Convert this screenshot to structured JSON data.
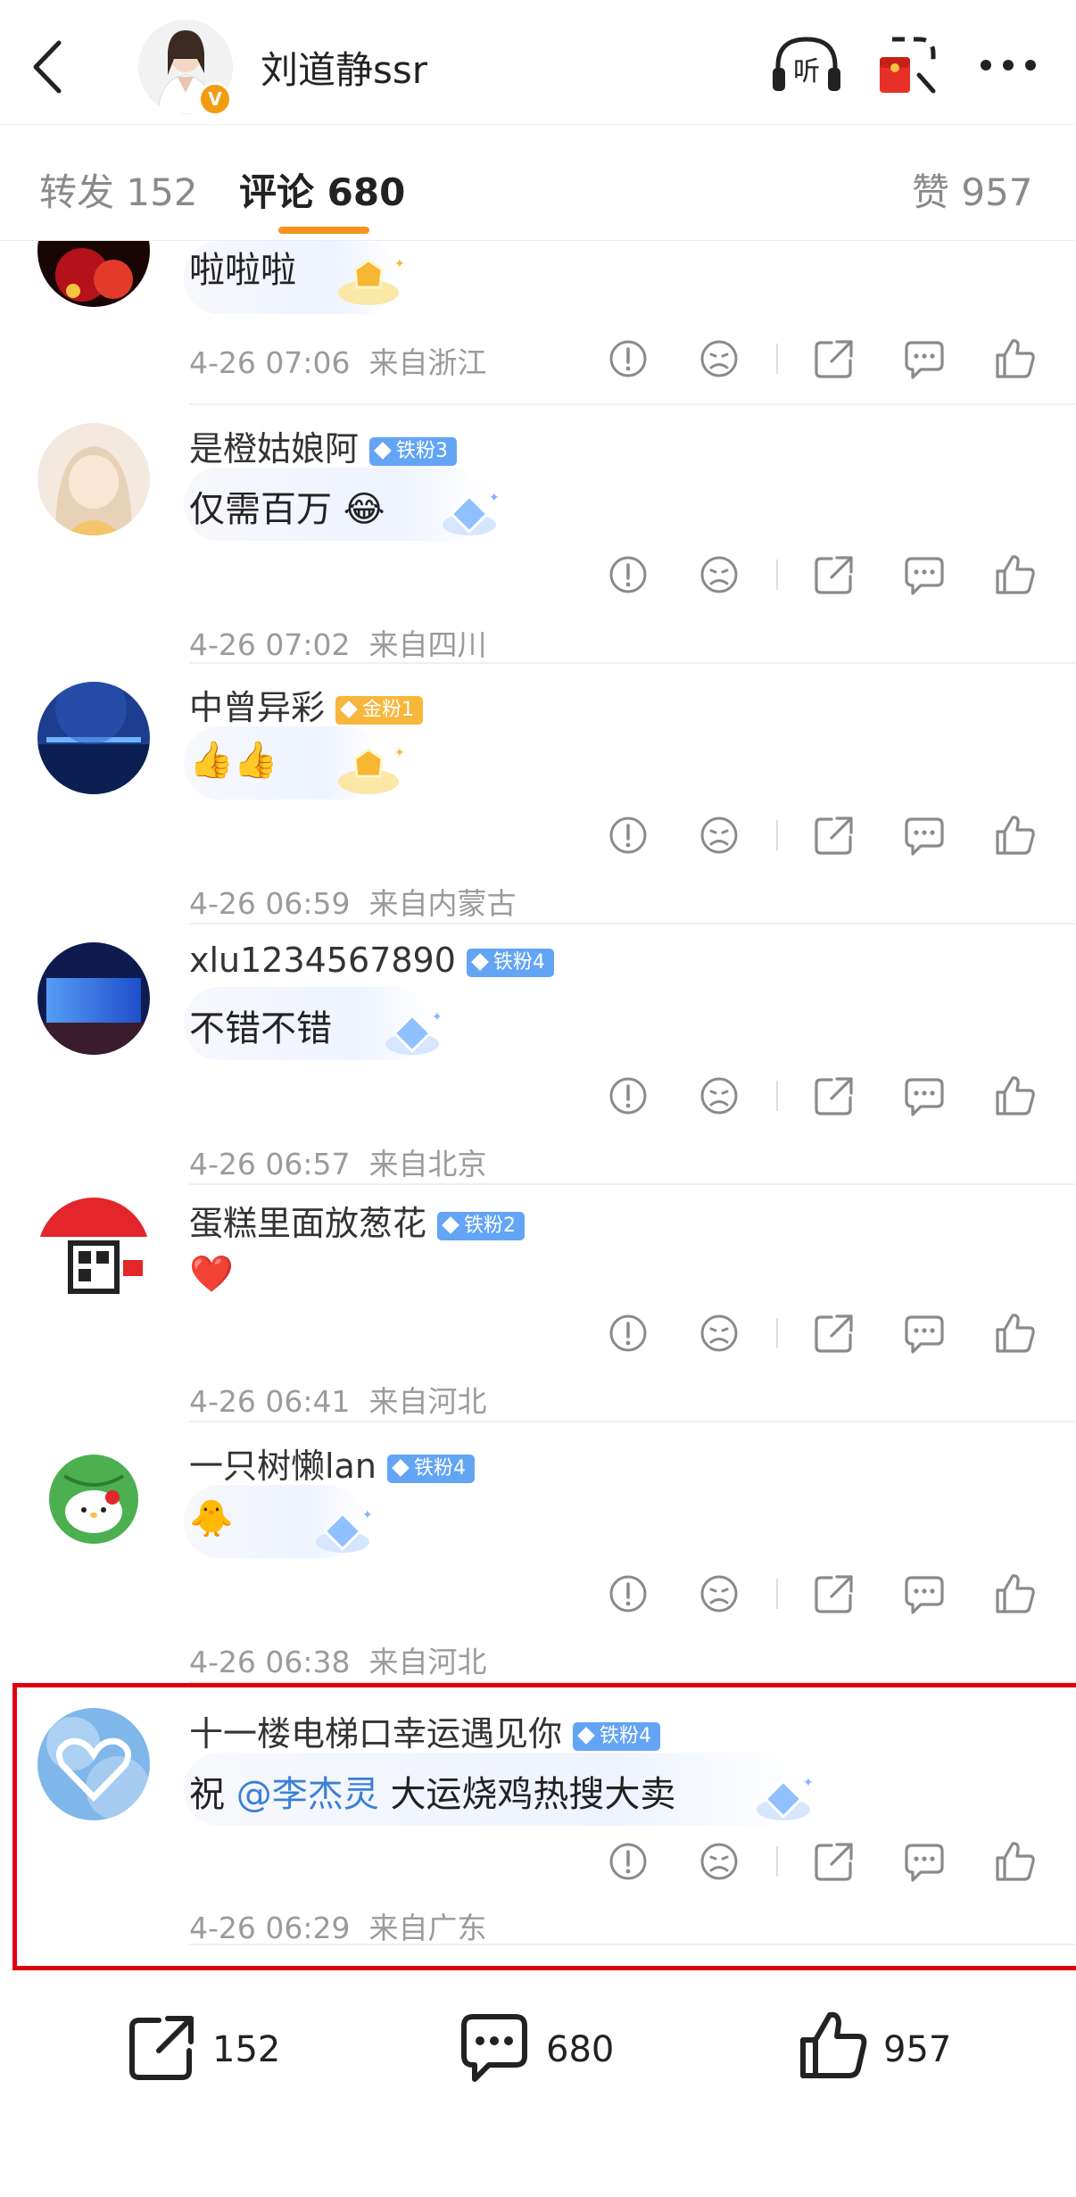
{
  "header": {
    "back_icon": "chevron-left-icon",
    "user_name": "刘道静ssr",
    "verified_badge": "V",
    "listen_label": "听",
    "more_icon": "more-dots-icon"
  },
  "tabs": [
    {
      "label": "转发 152",
      "active": false
    },
    {
      "label": "评论 680",
      "active": true
    },
    {
      "label": "赞 957",
      "active": false
    }
  ],
  "comments": [
    {
      "name": "",
      "badge": "",
      "content": "啦啦啦",
      "time": "4-26 07:06",
      "location": "来自浙江",
      "decor": "gold-star"
    },
    {
      "name": "是橙姑娘阿",
      "badge": "铁粉3",
      "content": "仅需百万",
      "emoji": "😂",
      "time": "4-26 07:02",
      "location": "来自四川",
      "decor": "blue-diamond"
    },
    {
      "name": "中曾异彩",
      "badge": "金粉1",
      "content": "",
      "emoji": "👍👍",
      "time": "4-26 06:59",
      "location": "来自内蒙古",
      "decor": "gold-star"
    },
    {
      "name": "xlu1234567890",
      "badge": "铁粉4",
      "content": "不错不错",
      "time": "4-26 06:57",
      "location": "来自北京",
      "decor": "blue-diamond"
    },
    {
      "name": "蛋糕里面放葱花",
      "badge": "铁粉2",
      "content": "",
      "emoji": "❤️",
      "time": "4-26 06:41",
      "location": "来自河北",
      "decor": ""
    },
    {
      "name": "一只树懒lan",
      "badge": "铁粉4",
      "content": "",
      "emoji": "🐥",
      "time": "4-26 06:38",
      "location": "来自河北",
      "decor": "blue-diamond"
    },
    {
      "name": "十一楼电梯口幸运遇见你",
      "badge": "铁粉4",
      "content_prefix": "祝",
      "mention": "@李杰灵",
      "content_suffix": "大运烧鸡热搜大卖",
      "time": "4-26 06:29",
      "location": "来自广东",
      "decor": "blue-diamond"
    }
  ],
  "actions": [
    "report-icon",
    "dislike-icon",
    "share-icon",
    "reply-icon",
    "like-icon"
  ],
  "bottombar": {
    "share_count": "152",
    "comment_count": "680",
    "like_count": "957"
  },
  "colors": {
    "accent": "#f7931e",
    "highlight_border": "#e0000b",
    "mention": "#3b7fd6",
    "fan_badge": "#63a4f5",
    "gold_badge": "#f6b73c"
  }
}
